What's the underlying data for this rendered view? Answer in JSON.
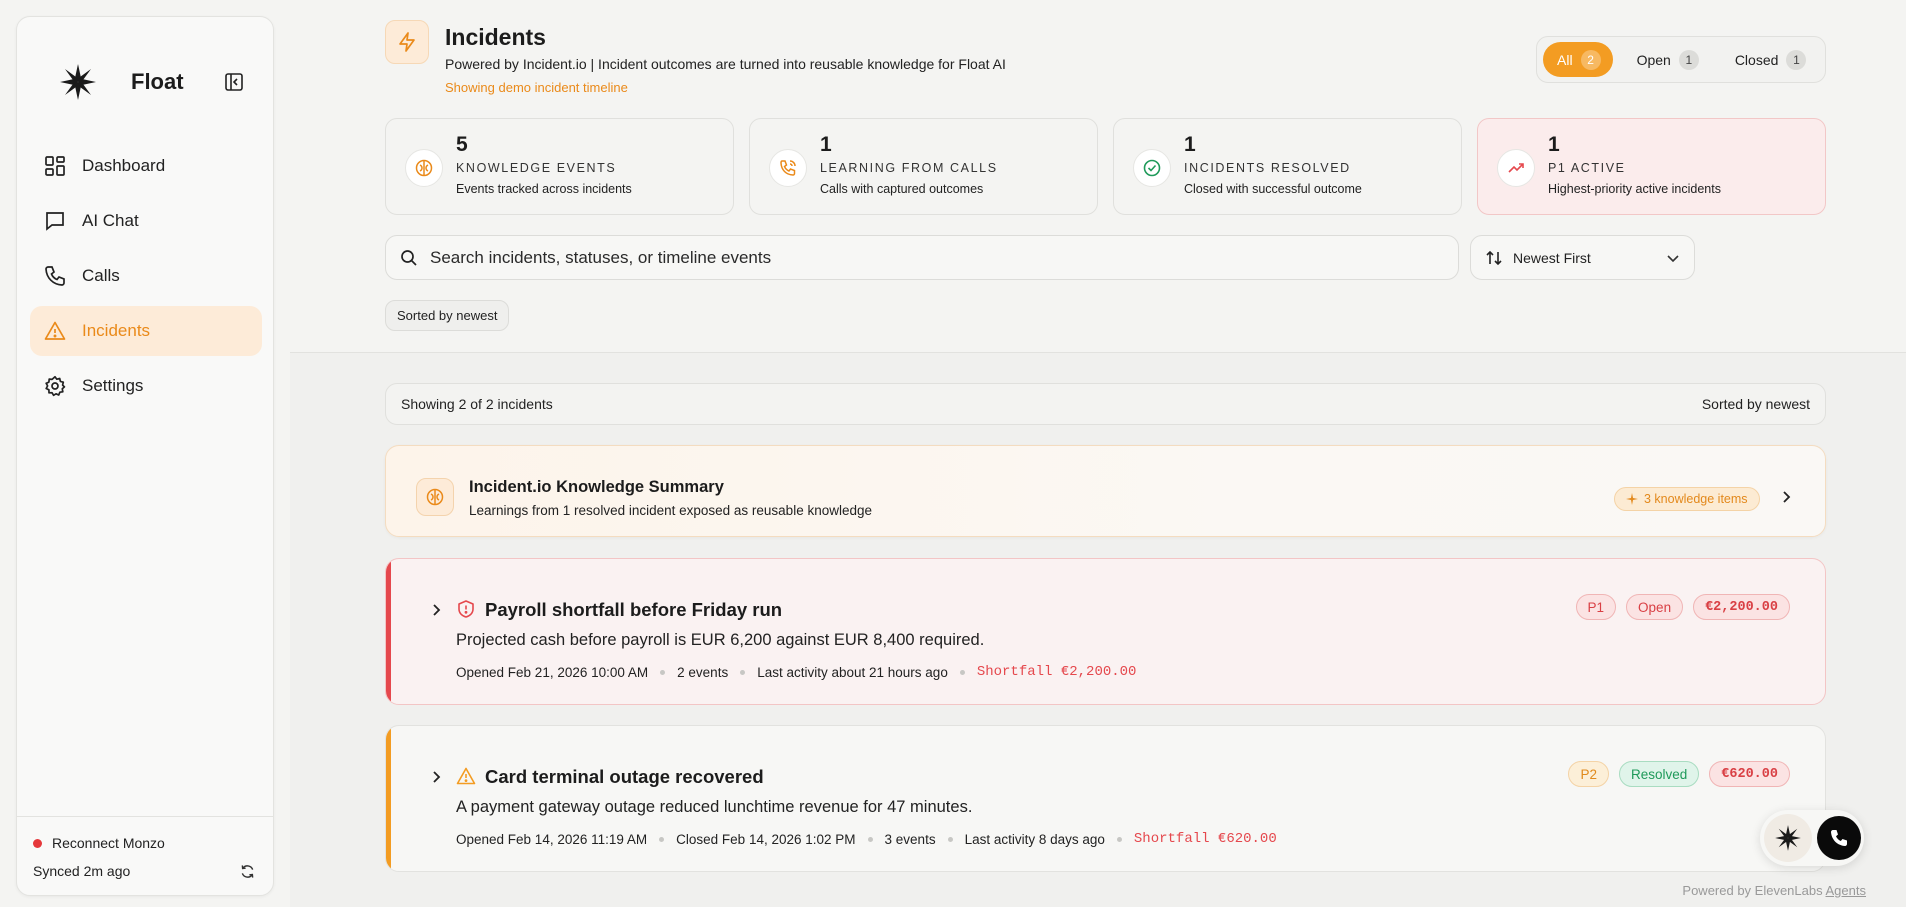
{
  "sidebar": {
    "brand": "Float",
    "items": [
      {
        "label": "Dashboard",
        "icon": "dashboard-icon"
      },
      {
        "label": "AI Chat",
        "icon": "chat-icon"
      },
      {
        "label": "Calls",
        "icon": "phone-icon"
      },
      {
        "label": "Incidents",
        "icon": "warning-icon",
        "active": true
      },
      {
        "label": "Settings",
        "icon": "gear-icon"
      }
    ],
    "footer": {
      "reconnect": "Reconnect Monzo",
      "synced": "Synced 2m ago"
    }
  },
  "header": {
    "title": "Incidents",
    "subtitle": "Powered by Incident.io | Incident outcomes are turned into reusable knowledge for Float AI",
    "demo_note": "Showing demo incident timeline",
    "filters": [
      {
        "label": "All",
        "count": "2",
        "active": true
      },
      {
        "label": "Open",
        "count": "1"
      },
      {
        "label": "Closed",
        "count": "1"
      }
    ]
  },
  "stats": [
    {
      "value": "5",
      "label": "KNOWLEDGE EVENTS",
      "desc": "Events tracked across incidents",
      "icon": "brain-icon"
    },
    {
      "value": "1",
      "label": "LEARNING FROM CALLS",
      "desc": "Calls with captured outcomes",
      "icon": "phone-call-icon"
    },
    {
      "value": "1",
      "label": "INCIDENTS RESOLVED",
      "desc": "Closed with successful outcome",
      "icon": "check-circle-icon"
    },
    {
      "value": "1",
      "label": "P1 ACTIVE",
      "desc": "Highest-priority active incidents",
      "icon": "trend-up-icon"
    }
  ],
  "search": {
    "placeholder": "Search incidents, statuses, or timeline events"
  },
  "sort": {
    "selected": "Newest First"
  },
  "sorted_chip": "Sorted by newest",
  "list": {
    "showing": "Showing 2 of 2 incidents",
    "sorted": "Sorted by newest"
  },
  "knowledge_summary": {
    "title": "Incident.io Knowledge Summary",
    "desc": "Learnings from 1 resolved incident exposed as reusable knowledge",
    "badge": "3 knowledge items"
  },
  "incidents": [
    {
      "title": "Payroll shortfall before Friday run",
      "desc": "Projected cash before payroll is EUR 6,200 against EUR 8,400 required.",
      "severity": "P1",
      "status": "Open",
      "amount": "€2,200.00",
      "meta": [
        "Opened Feb 21, 2026 10:00 AM",
        "2 events",
        "Last activity about 21 hours ago"
      ],
      "shortfall": "Shortfall €2,200.00"
    },
    {
      "title": "Card terminal outage recovered",
      "desc": "A payment gateway outage reduced lunchtime revenue for 47 minutes.",
      "severity": "P2",
      "status": "Resolved",
      "amount": "€620.00",
      "meta": [
        "Opened Feb 14, 2026 11:19 AM",
        "Closed Feb 14, 2026 1:02 PM",
        "3 events",
        "Last activity 8 days ago"
      ],
      "shortfall": "Shortfall €620.00"
    }
  ],
  "footer": {
    "powered_prefix": "Powered by ElevenLabs",
    "powered_link": "Agents"
  },
  "colors": {
    "accent": "#f39c22",
    "danger": "#e5484d",
    "success": "#1f9a5a"
  }
}
